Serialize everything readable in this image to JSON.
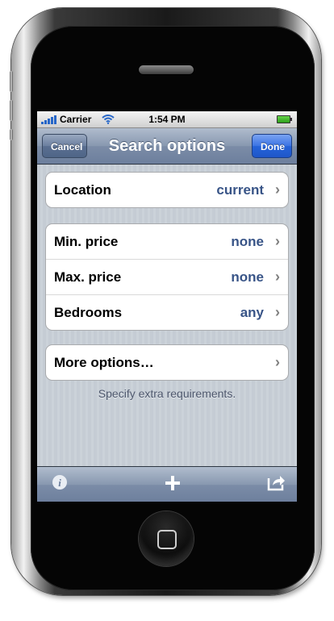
{
  "status_bar": {
    "carrier": "Carrier",
    "time": "1:54 PM"
  },
  "nav_bar": {
    "title": "Search options",
    "left_button": "Cancel",
    "right_button": "Done"
  },
  "groups": [
    {
      "rows": [
        {
          "label": "Location",
          "value": "current"
        }
      ]
    },
    {
      "rows": [
        {
          "label": "Min. price",
          "value": "none"
        },
        {
          "label": "Max. price",
          "value": "none"
        },
        {
          "label": "Bedrooms",
          "value": "any"
        }
      ]
    },
    {
      "rows": [
        {
          "label": "More options…",
          "value": ""
        }
      ]
    }
  ],
  "footer_note": "Specify extra requirements.",
  "toolbar": {
    "icons": [
      "info-icon",
      "add-icon",
      "share-icon"
    ]
  },
  "colors": {
    "value_text": "#385487",
    "done_button": "#2563da",
    "nav_bar": "#7b8ca7"
  }
}
